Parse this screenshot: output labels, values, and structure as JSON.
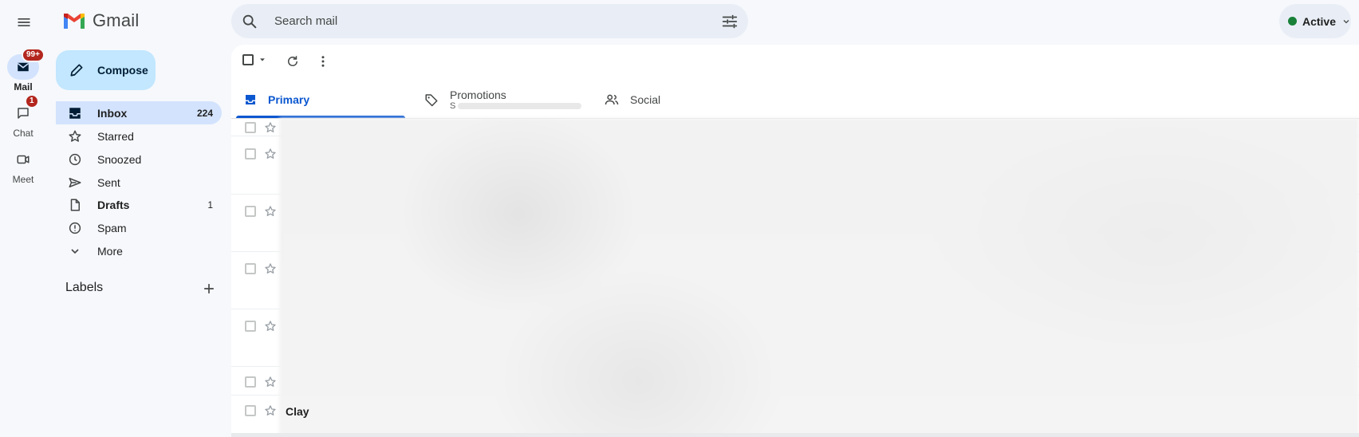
{
  "app": {
    "name": "Gmail"
  },
  "search": {
    "placeholder": "Search mail"
  },
  "status": {
    "label": "Active"
  },
  "rail": {
    "mail": {
      "label": "Mail",
      "badge": "99+"
    },
    "chat": {
      "label": "Chat",
      "badge": "1"
    },
    "meet": {
      "label": "Meet"
    }
  },
  "compose": {
    "label": "Compose"
  },
  "nav": {
    "inbox": {
      "label": "Inbox",
      "count": "224"
    },
    "starred": {
      "label": "Starred"
    },
    "snoozed": {
      "label": "Snoozed"
    },
    "sent": {
      "label": "Sent"
    },
    "drafts": {
      "label": "Drafts",
      "count": "1"
    },
    "spam": {
      "label": "Spam"
    },
    "more": {
      "label": "More"
    }
  },
  "labels": {
    "title": "Labels"
  },
  "tabs": {
    "primary": {
      "label": "Primary"
    },
    "promotions": {
      "label": "Promotions",
      "sublabel": "S"
    },
    "social": {
      "label": "Social"
    }
  },
  "rows": {
    "last_sender": "Clay"
  },
  "colors": {
    "accent": "#0b57d0",
    "compose_bg": "#c2e7ff",
    "active_nav": "#d3e3fd",
    "badge": "#b3261e",
    "status_dot": "#188038"
  }
}
